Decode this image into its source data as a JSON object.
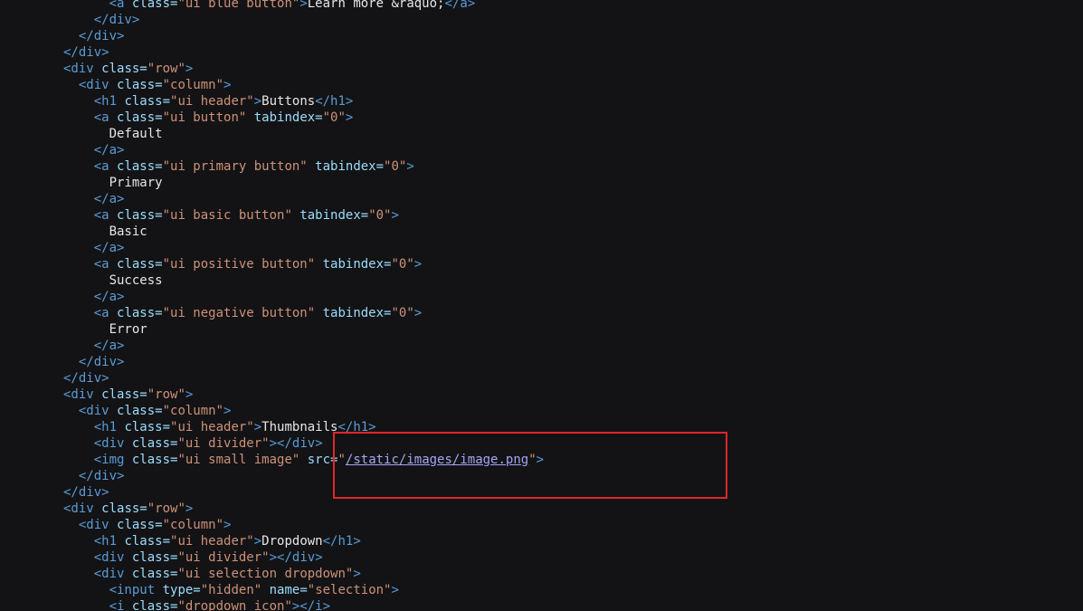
{
  "colors": {
    "background": "#131315",
    "tag": "#5a9bd6",
    "attr": "#9cdcfe",
    "string": "#ce9178",
    "text": "#e6e6e6",
    "link": "#a5a5f5",
    "highlight": "#e0262a"
  },
  "lines": [
    [
      [
        "      ",
        "text"
      ],
      [
        "<a ",
        "tag"
      ],
      [
        "class=",
        "attr"
      ],
      [
        "\"ui blue button\"",
        "str"
      ],
      [
        ">",
        "tag"
      ],
      [
        "Learn more &raquo;",
        "text"
      ],
      [
        "</a>",
        "tag"
      ]
    ],
    [
      [
        "    ",
        "text"
      ],
      [
        "</div>",
        "tag"
      ]
    ],
    [
      [
        "  ",
        "text"
      ],
      [
        "</div>",
        "tag"
      ]
    ],
    [
      [
        "</div>",
        "tag"
      ]
    ],
    [
      [
        "<div ",
        "tag"
      ],
      [
        "class=",
        "attr"
      ],
      [
        "\"row\"",
        "str"
      ],
      [
        ">",
        "tag"
      ]
    ],
    [
      [
        "  ",
        "text"
      ],
      [
        "<div ",
        "tag"
      ],
      [
        "class=",
        "attr"
      ],
      [
        "\"column\"",
        "str"
      ],
      [
        ">",
        "tag"
      ]
    ],
    [
      [
        "    ",
        "text"
      ],
      [
        "<h1 ",
        "tag"
      ],
      [
        "class=",
        "attr"
      ],
      [
        "\"ui header\"",
        "str"
      ],
      [
        ">",
        "tag"
      ],
      [
        "Buttons",
        "text"
      ],
      [
        "</h1>",
        "tag"
      ]
    ],
    [
      [
        "    ",
        "text"
      ],
      [
        "<a ",
        "tag"
      ],
      [
        "class=",
        "attr"
      ],
      [
        "\"ui button\"",
        "str"
      ],
      [
        " tabindex=",
        "attr"
      ],
      [
        "\"0\"",
        "str"
      ],
      [
        ">",
        "tag"
      ]
    ],
    [
      [
        "      Default",
        "text"
      ]
    ],
    [
      [
        "    ",
        "text"
      ],
      [
        "</a>",
        "tag"
      ]
    ],
    [
      [
        "    ",
        "text"
      ],
      [
        "<a ",
        "tag"
      ],
      [
        "class=",
        "attr"
      ],
      [
        "\"ui primary button\"",
        "str"
      ],
      [
        " tabindex=",
        "attr"
      ],
      [
        "\"0\"",
        "str"
      ],
      [
        ">",
        "tag"
      ]
    ],
    [
      [
        "      Primary",
        "text"
      ]
    ],
    [
      [
        "    ",
        "text"
      ],
      [
        "</a>",
        "tag"
      ]
    ],
    [
      [
        "    ",
        "text"
      ],
      [
        "<a ",
        "tag"
      ],
      [
        "class=",
        "attr"
      ],
      [
        "\"ui basic button\"",
        "str"
      ],
      [
        " tabindex=",
        "attr"
      ],
      [
        "\"0\"",
        "str"
      ],
      [
        ">",
        "tag"
      ]
    ],
    [
      [
        "      Basic",
        "text"
      ]
    ],
    [
      [
        "    ",
        "text"
      ],
      [
        "</a>",
        "tag"
      ]
    ],
    [
      [
        "    ",
        "text"
      ],
      [
        "<a ",
        "tag"
      ],
      [
        "class=",
        "attr"
      ],
      [
        "\"ui positive button\"",
        "str"
      ],
      [
        " tabindex=",
        "attr"
      ],
      [
        "\"0\"",
        "str"
      ],
      [
        ">",
        "tag"
      ]
    ],
    [
      [
        "      Success",
        "text"
      ]
    ],
    [
      [
        "    ",
        "text"
      ],
      [
        "</a>",
        "tag"
      ]
    ],
    [
      [
        "    ",
        "text"
      ],
      [
        "<a ",
        "tag"
      ],
      [
        "class=",
        "attr"
      ],
      [
        "\"ui negative button\"",
        "str"
      ],
      [
        " tabindex=",
        "attr"
      ],
      [
        "\"0\"",
        "str"
      ],
      [
        ">",
        "tag"
      ]
    ],
    [
      [
        "      Error",
        "text"
      ]
    ],
    [
      [
        "    ",
        "text"
      ],
      [
        "</a>",
        "tag"
      ]
    ],
    [
      [
        "  ",
        "text"
      ],
      [
        "</div>",
        "tag"
      ]
    ],
    [
      [
        "</div>",
        "tag"
      ]
    ],
    [
      [
        "<div ",
        "tag"
      ],
      [
        "class=",
        "attr"
      ],
      [
        "\"row\"",
        "str"
      ],
      [
        ">",
        "tag"
      ]
    ],
    [
      [
        "  ",
        "text"
      ],
      [
        "<div ",
        "tag"
      ],
      [
        "class=",
        "attr"
      ],
      [
        "\"column\"",
        "str"
      ],
      [
        ">",
        "tag"
      ]
    ],
    [
      [
        "    ",
        "text"
      ],
      [
        "<h1 ",
        "tag"
      ],
      [
        "class=",
        "attr"
      ],
      [
        "\"ui header\"",
        "str"
      ],
      [
        ">",
        "tag"
      ],
      [
        "Thumbnails",
        "text"
      ],
      [
        "</h1>",
        "tag"
      ]
    ],
    [
      [
        "    ",
        "text"
      ],
      [
        "<div ",
        "tag"
      ],
      [
        "class=",
        "attr"
      ],
      [
        "\"ui divider\"",
        "str"
      ],
      [
        ">",
        "tag"
      ],
      [
        "</div>",
        "tag"
      ]
    ],
    [
      [
        "    ",
        "text"
      ],
      [
        "<img ",
        "tag"
      ],
      [
        "class=",
        "attr"
      ],
      [
        "\"ui small image\"",
        "str"
      ],
      [
        " src=",
        "attr"
      ],
      [
        "\"",
        "str"
      ],
      [
        "/static/images/image.png",
        "link"
      ],
      [
        "\"",
        "str"
      ],
      [
        ">",
        "tag"
      ]
    ],
    [
      [
        "  ",
        "text"
      ],
      [
        "</div>",
        "tag"
      ]
    ],
    [
      [
        "</div>",
        "tag"
      ]
    ],
    [
      [
        "<div ",
        "tag"
      ],
      [
        "class=",
        "attr"
      ],
      [
        "\"row\"",
        "str"
      ],
      [
        ">",
        "tag"
      ]
    ],
    [
      [
        "  ",
        "text"
      ],
      [
        "<div ",
        "tag"
      ],
      [
        "class=",
        "attr"
      ],
      [
        "\"column\"",
        "str"
      ],
      [
        ">",
        "tag"
      ]
    ],
    [
      [
        "    ",
        "text"
      ],
      [
        "<h1 ",
        "tag"
      ],
      [
        "class=",
        "attr"
      ],
      [
        "\"ui header\"",
        "str"
      ],
      [
        ">",
        "tag"
      ],
      [
        "Dropdown",
        "text"
      ],
      [
        "</h1>",
        "tag"
      ]
    ],
    [
      [
        "    ",
        "text"
      ],
      [
        "<div ",
        "tag"
      ],
      [
        "class=",
        "attr"
      ],
      [
        "\"ui divider\"",
        "str"
      ],
      [
        ">",
        "tag"
      ],
      [
        "</div>",
        "tag"
      ]
    ],
    [
      [
        "    ",
        "text"
      ],
      [
        "<div ",
        "tag"
      ],
      [
        "class=",
        "attr"
      ],
      [
        "\"ui selection dropdown\"",
        "str"
      ],
      [
        ">",
        "tag"
      ]
    ],
    [
      [
        "      ",
        "text"
      ],
      [
        "<input ",
        "tag"
      ],
      [
        "type=",
        "attr"
      ],
      [
        "\"hidden\"",
        "str"
      ],
      [
        " name=",
        "attr"
      ],
      [
        "\"selection\"",
        "str"
      ],
      [
        ">",
        "tag"
      ]
    ],
    [
      [
        "      ",
        "text"
      ],
      [
        "<i ",
        "tag"
      ],
      [
        "class=",
        "attr"
      ],
      [
        "\"dropdown icon\"",
        "str"
      ],
      [
        ">",
        "tag"
      ],
      [
        "</i>",
        "tag"
      ]
    ]
  ]
}
